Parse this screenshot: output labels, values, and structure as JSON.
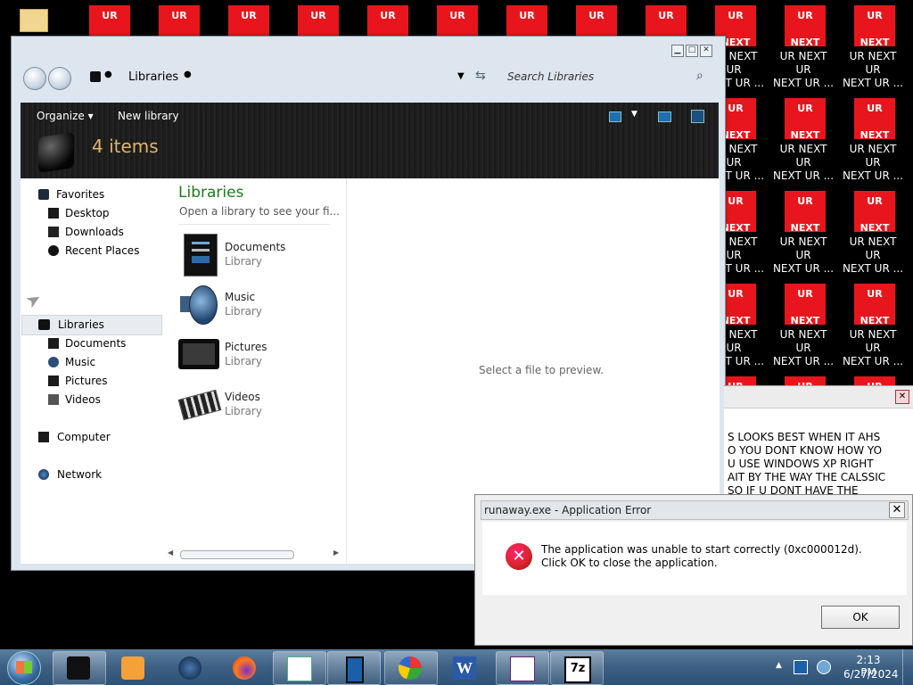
{
  "desktop": {
    "icon_top": "UR",
    "icon_bottom": "NEXT",
    "icon_label_line1": "UR NEXT UR",
    "icon_label_line2": "NEXT UR ...",
    "partial_label_ext": "EXT",
    "partial_label_line1": "EXT UR",
    "partial_label_line2": "T UR ..."
  },
  "explorer": {
    "address_location": "Libraries",
    "search_placeholder": "Search Libraries",
    "toolbar": {
      "organize_label": "Organize",
      "new_library_label": "New library",
      "item_count": "4 items"
    },
    "nav": {
      "favorites": "Favorites",
      "desktop": "Desktop",
      "downloads": "Downloads",
      "recent_places": "Recent Places",
      "libraries": "Libraries",
      "documents": "Documents",
      "music": "Music",
      "pictures": "Pictures",
      "videos": "Videos",
      "computer": "Computer",
      "network": "Network"
    },
    "content": {
      "heading": "Libraries",
      "subheading": "Open a library to see your fi...",
      "items": [
        {
          "name": "Documents",
          "type": "Library",
          "icon": "documents-icon"
        },
        {
          "name": "Music",
          "type": "Library",
          "icon": "music-icon"
        },
        {
          "name": "Pictures",
          "type": "Library",
          "icon": "pictures-icon"
        },
        {
          "name": "Videos",
          "type": "Library",
          "icon": "videos-icon"
        }
      ]
    },
    "preview_text": "Select a file to preview."
  },
  "message_window": {
    "lines": [
      "S LOOKS BEST WHEN IT AHS",
      "O YOU DONT KNOW HOW YO",
      "U USE WINDOWS XP RIGHT",
      "AIT BY THE WAY THE CALSSIC",
      "SO IF U DONT HAVE THE"
    ]
  },
  "error_dialog": {
    "title": "runaway.exe - Application Error",
    "message": "The application was unable to start correctly (0xc000012d). Click OK to close the application.",
    "ok_label": "OK"
  },
  "taskbar": {
    "time": "2:13 PM",
    "date": "6/27/2024",
    "apps": [
      "explorer",
      "media-player",
      "globe",
      "firefox",
      "notepad",
      "phone",
      "chart",
      "word",
      "visual-studio",
      "7zip"
    ]
  },
  "colors": {
    "desktop_icon_red": "#e8161c",
    "library_heading_green": "#1e7a1e",
    "error_red": "#d9262c"
  }
}
